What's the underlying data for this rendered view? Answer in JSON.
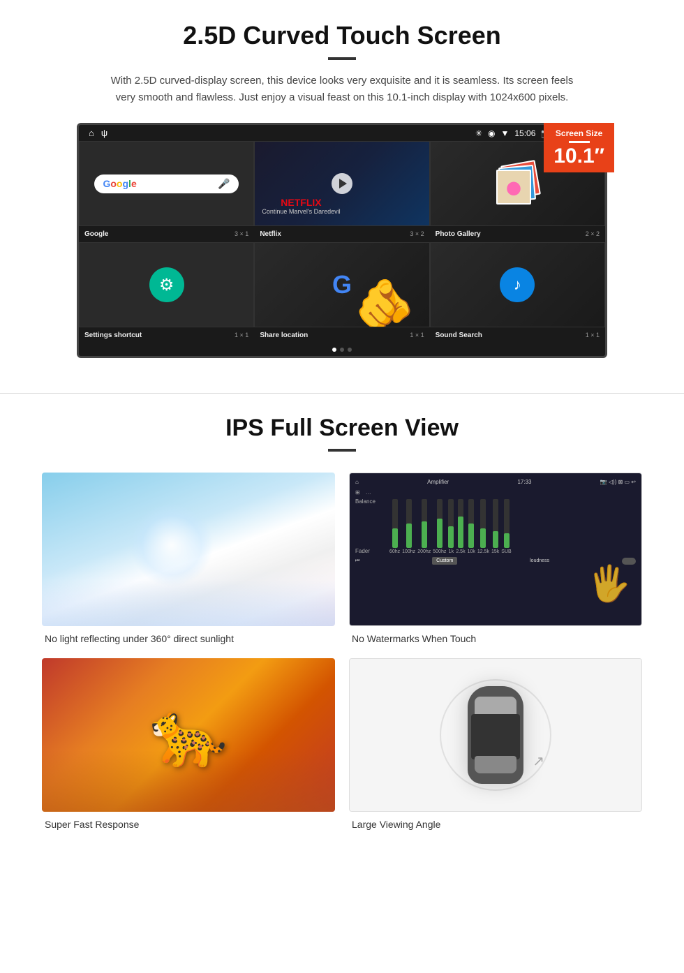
{
  "section1": {
    "title": "2.5D Curved Touch Screen",
    "description": "With 2.5D curved-display screen, this device looks very exquisite and it is seamless. Its screen feels very smooth and flawless. Just enjoy a visual feast on this 10.1-inch display with 1024x600 pixels.",
    "screen_size_label": "Screen Size",
    "screen_size_value": "10.1″",
    "status_bar": {
      "time": "15:06",
      "icons_left": [
        "home",
        "usb"
      ],
      "icons_right": [
        "bluetooth",
        "location",
        "wifi",
        "camera",
        "volume",
        "x",
        "rect"
      ]
    },
    "apps": [
      {
        "name": "Google",
        "size": "3 × 1"
      },
      {
        "name": "Netflix",
        "size": "3 × 2"
      },
      {
        "name": "Photo Gallery",
        "size": "2 × 2"
      },
      {
        "name": "Settings shortcut",
        "size": "1 × 1"
      },
      {
        "name": "Share location",
        "size": "1 × 1"
      },
      {
        "name": "Sound Search",
        "size": "1 × 1"
      }
    ],
    "netflix_text": "NETFLIX",
    "netflix_subtext": "Continue Marvel's Daredevil"
  },
  "section2": {
    "title": "IPS Full Screen View",
    "features": [
      {
        "id": "sunlight",
        "caption": "No light reflecting under 360° direct sunlight"
      },
      {
        "id": "watermarks",
        "caption": "No Watermarks When Touch"
      },
      {
        "id": "cheetah",
        "caption": "Super Fast Response"
      },
      {
        "id": "car",
        "caption": "Large Viewing Angle"
      }
    ],
    "amplifier": {
      "title": "Amplifier",
      "time": "17:33",
      "labels": [
        "60hz",
        "100hz",
        "200hz",
        "500hz",
        "1k",
        "2.5k",
        "10k",
        "12.5k",
        "15k",
        "SUB"
      ],
      "heights": [
        40,
        50,
        55,
        60,
        45,
        65,
        50,
        40,
        35,
        30
      ],
      "balance_label": "Balance",
      "fader_label": "Fader",
      "custom_label": "Custom",
      "loudness_label": "loudness"
    }
  }
}
